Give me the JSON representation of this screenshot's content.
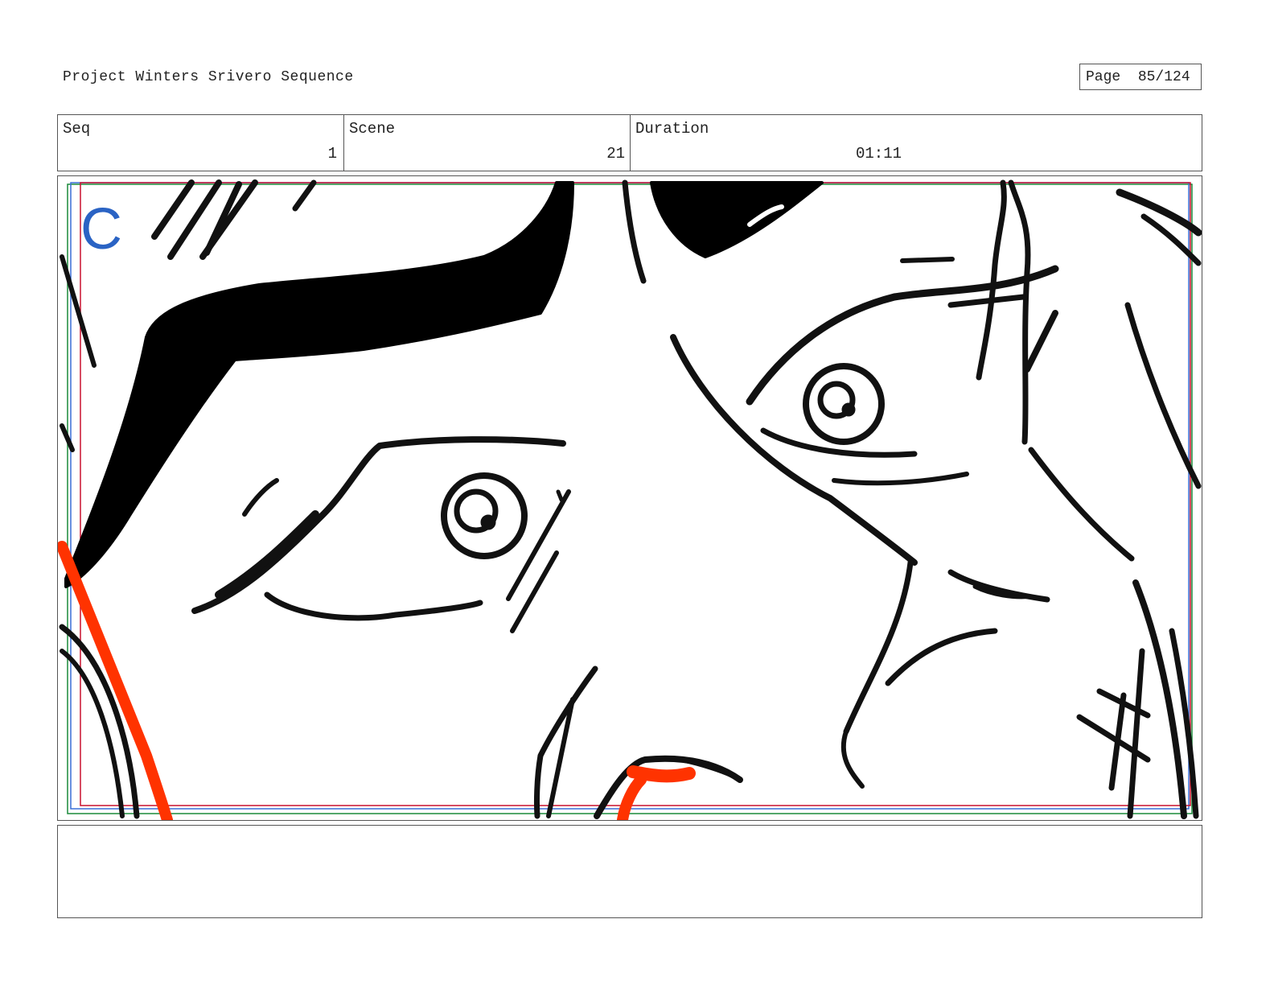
{
  "header": {
    "project_title": "Project Winters Srivero Sequence",
    "page_label": "Page",
    "page_value": "85/124"
  },
  "info": {
    "seq_label": "Seq",
    "seq_value": "1",
    "scene_label": "Scene",
    "scene_value": "21",
    "duration_label": "Duration",
    "duration_value": "01:11"
  },
  "panel": {
    "letter": "C",
    "content": "storyboard sketch",
    "colors": {
      "ink": "#111111",
      "accent_red": "#ff3300",
      "frame_red": "#c8102e",
      "frame_green": "#1a8a3a",
      "frame_blue": "#3a6fd8",
      "letter_blue": "#2a63c4"
    }
  },
  "notes": {
    "text": ""
  }
}
